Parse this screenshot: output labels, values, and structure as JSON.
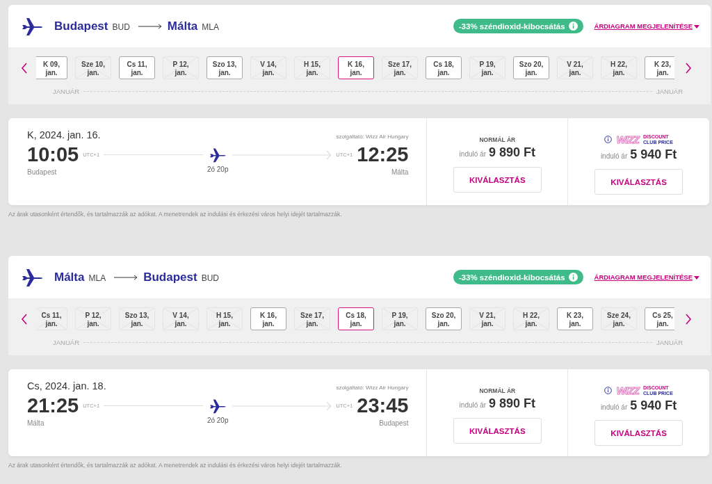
{
  "sections": [
    {
      "route": {
        "from": "Budapest",
        "from_code": "BUD",
        "to": "Málta",
        "to_code": "MLA"
      },
      "co2_badge": "-33% széndioxid-kibocsátás",
      "chart_link": "ÁRDIAGRAM MEGJELENÍTÉSE",
      "dates": [
        {
          "day": "K 09,",
          "month": "jan.",
          "available": true,
          "selected": false
        },
        {
          "day": "Sze 10,",
          "month": "jan.",
          "available": false,
          "selected": false
        },
        {
          "day": "Cs 11,",
          "month": "jan.",
          "available": true,
          "selected": false
        },
        {
          "day": "P 12,",
          "month": "jan.",
          "available": false,
          "selected": false
        },
        {
          "day": "Szo 13,",
          "month": "jan.",
          "available": true,
          "selected": false
        },
        {
          "day": "V 14,",
          "month": "jan.",
          "available": false,
          "selected": false
        },
        {
          "day": "H 15,",
          "month": "jan.",
          "available": false,
          "selected": false
        },
        {
          "day": "K 16,",
          "month": "jan.",
          "available": true,
          "selected": true
        },
        {
          "day": "Sze 17,",
          "month": "jan.",
          "available": false,
          "selected": false
        },
        {
          "day": "Cs 18,",
          "month": "jan.",
          "available": true,
          "selected": false
        },
        {
          "day": "P 19,",
          "month": "jan.",
          "available": false,
          "selected": false
        },
        {
          "day": "Szo 20,",
          "month": "jan.",
          "available": true,
          "selected": false
        },
        {
          "day": "V 21,",
          "month": "jan.",
          "available": false,
          "selected": false
        },
        {
          "day": "H 22,",
          "month": "jan.",
          "available": false,
          "selected": false
        },
        {
          "day": "K 23,",
          "month": "jan.",
          "available": true,
          "selected": false
        }
      ],
      "month_left": "JANUÁR",
      "month_right": "JANUÁR",
      "flight": {
        "date": "K, 2024. jan. 16.",
        "operator": "szolgáltató: Wizz Air Hungary",
        "depart_time": "10:05",
        "depart_tz": "UTC+1",
        "arrive_tz": "UTC+1",
        "arrive_time": "12:25",
        "duration": "2ó 20p",
        "from": "Budapest",
        "to": "Málta"
      },
      "fares": [
        {
          "kind": "normal",
          "title": "NORMÁL ÁR",
          "prefix": "induló ár",
          "price": "9 890 Ft",
          "button": "KIVÁLASZTÁS"
        },
        {
          "kind": "club",
          "logo": "WIZZ",
          "logo_top": "DISCOUNT",
          "logo_bottom": "CLUB PRICE",
          "prefix": "induló ár",
          "price": "5 940 Ft",
          "button": "KIVÁLASZTÁS"
        }
      ],
      "note": "Az árak utasonként értendők, és tartalmazzák az adókat. A menetrendek az indulási és érkezési város helyi idejét tartalmazzák."
    },
    {
      "route": {
        "from": "Málta",
        "from_code": "MLA",
        "to": "Budapest",
        "to_code": "BUD"
      },
      "co2_badge": "-33% széndioxid-kibocsátás",
      "chart_link": "ÁRDIAGRAM MEGJELENÍTÉSE",
      "dates": [
        {
          "day": "Cs 11,",
          "month": "jan.",
          "available": false,
          "selected": false
        },
        {
          "day": "P 12,",
          "month": "jan.",
          "available": false,
          "selected": false
        },
        {
          "day": "Szo 13,",
          "month": "jan.",
          "available": false,
          "selected": false
        },
        {
          "day": "V 14,",
          "month": "jan.",
          "available": false,
          "selected": false
        },
        {
          "day": "H 15,",
          "month": "jan.",
          "available": false,
          "selected": false
        },
        {
          "day": "K 16,",
          "month": "jan.",
          "available": true,
          "selected": false
        },
        {
          "day": "Sze 17,",
          "month": "jan.",
          "available": false,
          "selected": false
        },
        {
          "day": "Cs 18,",
          "month": "jan.",
          "available": true,
          "selected": true
        },
        {
          "day": "P 19,",
          "month": "jan.",
          "available": false,
          "selected": false
        },
        {
          "day": "Szo 20,",
          "month": "jan.",
          "available": true,
          "selected": false
        },
        {
          "day": "V 21,",
          "month": "jan.",
          "available": false,
          "selected": false
        },
        {
          "day": "H 22,",
          "month": "jan.",
          "available": false,
          "selected": false
        },
        {
          "day": "K 23,",
          "month": "jan.",
          "available": true,
          "selected": false
        },
        {
          "day": "Sze 24,",
          "month": "jan.",
          "available": false,
          "selected": false
        },
        {
          "day": "Cs 25,",
          "month": "jan.",
          "available": true,
          "selected": false
        }
      ],
      "month_left": "JANUÁR",
      "month_right": "JANUÁR",
      "flight": {
        "date": "Cs, 2024. jan. 18.",
        "operator": "szolgáltató: Wizz Air Hungary",
        "depart_time": "21:25",
        "depart_tz": "UTC+1",
        "arrive_tz": "UTC+1",
        "arrive_time": "23:45",
        "duration": "2ó 20p",
        "from": "Málta",
        "to": "Budapest"
      },
      "fares": [
        {
          "kind": "normal",
          "title": "NORMÁL ÁR",
          "prefix": "induló ár",
          "price": "9 890 Ft",
          "button": "KIVÁLASZTÁS"
        },
        {
          "kind": "club",
          "logo": "WIZZ",
          "logo_top": "DISCOUNT",
          "logo_bottom": "CLUB PRICE",
          "prefix": "induló ár",
          "price": "5 940 Ft",
          "button": "KIVÁLASZTÁS"
        }
      ],
      "note": "Az árak utasonként értendők, és tartalmazzák az adókat. A menetrendek az indulási és érkezési város helyi idejét tartalmazzák."
    }
  ]
}
